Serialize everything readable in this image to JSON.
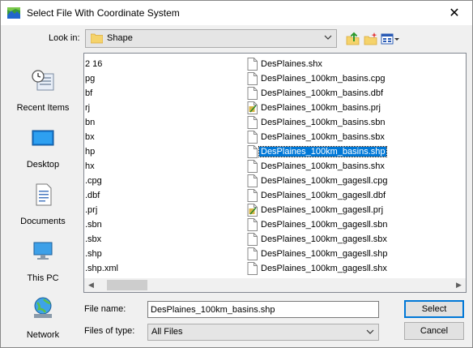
{
  "window": {
    "title": "Select File With Coordinate System",
    "close_glyph": "✕"
  },
  "lookin": {
    "label": "Look in:",
    "value": "Shape"
  },
  "places": [
    {
      "label": "Recent Items",
      "icon": "recent-items-icon"
    },
    {
      "label": "Desktop",
      "icon": "desktop-icon"
    },
    {
      "label": "Documents",
      "icon": "documents-icon"
    },
    {
      "label": "This PC",
      "icon": "this-pc-icon"
    },
    {
      "label": "Network",
      "icon": "network-icon"
    }
  ],
  "files": {
    "col1": [
      "2 16",
      "pg",
      "bf",
      "rj",
      "bn",
      "bx",
      "hp",
      "hx",
      ".cpg",
      ".dbf",
      ".prj",
      ".sbn",
      ".sbx",
      ".shp",
      ".shp.xml"
    ],
    "col2": [
      {
        "name": "DesPlaines.shx",
        "icon": "file-icon"
      },
      {
        "name": "DesPlaines_100km_basins.cpg",
        "icon": "file-icon"
      },
      {
        "name": "DesPlaines_100km_basins.dbf",
        "icon": "file-icon"
      },
      {
        "name": "DesPlaines_100km_basins.prj",
        "icon": "prj-file-icon"
      },
      {
        "name": "DesPlaines_100km_basins.sbn",
        "icon": "file-icon"
      },
      {
        "name": "DesPlaines_100km_basins.sbx",
        "icon": "file-icon"
      },
      {
        "name": "DesPlaines_100km_basins.shp",
        "icon": "file-icon",
        "selected": true
      },
      {
        "name": "DesPlaines_100km_basins.shx",
        "icon": "file-icon"
      },
      {
        "name": "DesPlaines_100km_gagesll.cpg",
        "icon": "file-icon"
      },
      {
        "name": "DesPlaines_100km_gagesll.dbf",
        "icon": "file-icon"
      },
      {
        "name": "DesPlaines_100km_gagesll.prj",
        "icon": "prj-file-icon"
      },
      {
        "name": "DesPlaines_100km_gagesll.sbn",
        "icon": "file-icon"
      },
      {
        "name": "DesPlaines_100km_gagesll.sbx",
        "icon": "file-icon"
      },
      {
        "name": "DesPlaines_100km_gagesll.shp",
        "icon": "file-icon"
      },
      {
        "name": "DesPlaines_100km_gagesll.shx",
        "icon": "file-icon"
      }
    ]
  },
  "filename": {
    "label": "File name:",
    "value": "DesPlaines_100km_basins.shp"
  },
  "filetype": {
    "label": "Files of type:",
    "value": "All Files"
  },
  "buttons": {
    "select": "Select",
    "cancel": "Cancel"
  },
  "colors": {
    "selection": "#0078d7",
    "window_bg": "#f0f0f0"
  }
}
